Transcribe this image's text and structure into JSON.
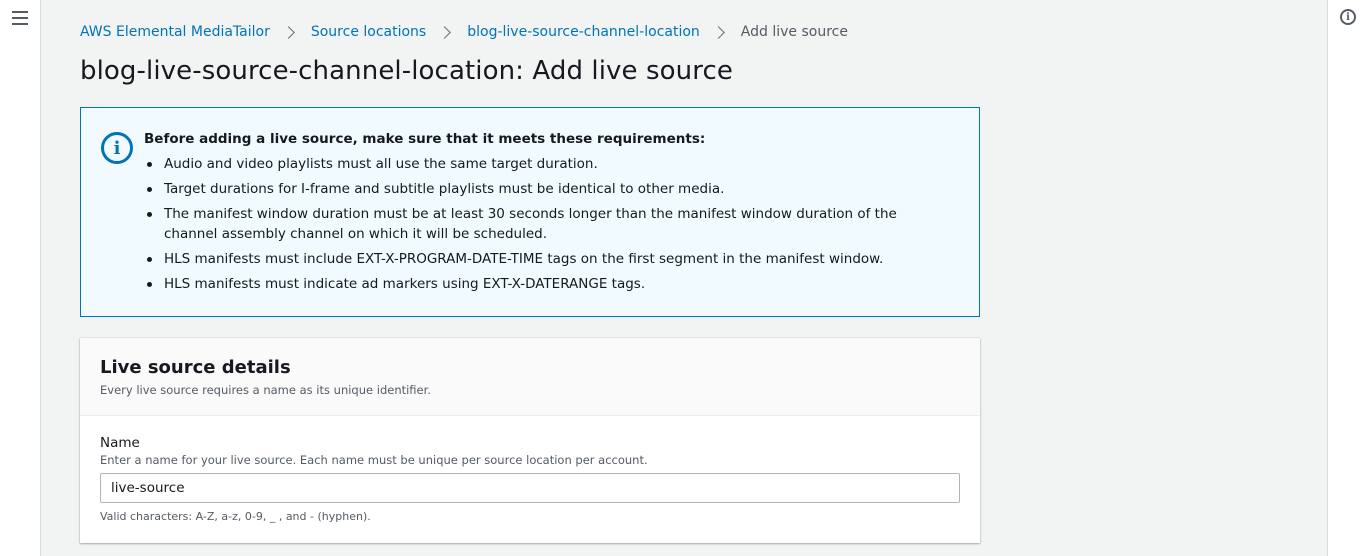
{
  "breadcrumb": {
    "items": [
      "AWS Elemental MediaTailor",
      "Source locations",
      "blog-live-source-channel-location"
    ],
    "current": "Add live source"
  },
  "page_title": "blog-live-source-channel-location: Add live source",
  "alert": {
    "title": "Before adding a live source, make sure that it meets these requirements:",
    "items": [
      "Audio and video playlists must all use the same target duration.",
      "Target durations for I-frame and subtitle playlists must be identical to other media.",
      "The manifest window duration must be at least 30 seconds longer than the manifest window duration of the channel assembly channel on which it will be scheduled.",
      "HLS manifests must include EXT-X-PROGRAM-DATE-TIME tags on the first segment in the manifest window.",
      "HLS manifests must indicate ad markers using EXT-X-DATERANGE tags."
    ]
  },
  "panel": {
    "title": "Live source details",
    "description": "Every live source requires a name as its unique identifier.",
    "name_field": {
      "label": "Name",
      "description": "Enter a name for your live source. Each name must be unique per source location per account.",
      "value": "live-source",
      "constraint": "Valid characters: A-Z, a-z, 0-9, _ , and - (hyphen)."
    }
  },
  "icons": {
    "menu": "hamburger-menu-icon",
    "info": "info-icon",
    "alert": "info-circle-icon"
  },
  "colors": {
    "link": "#0073bb",
    "alert_bg": "#f1faff",
    "alert_border": "#0073bb"
  }
}
